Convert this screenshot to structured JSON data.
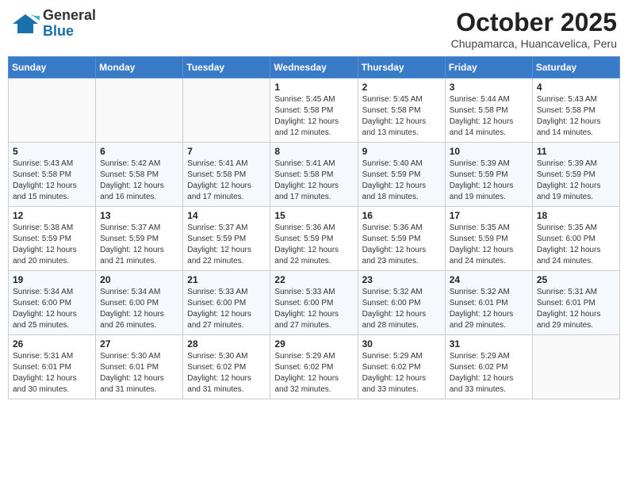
{
  "header": {
    "logo_general": "General",
    "logo_blue": "Blue",
    "month_year": "October 2025",
    "subtitle": "Chupamarca, Huancavelica, Peru"
  },
  "days_of_week": [
    "Sunday",
    "Monday",
    "Tuesday",
    "Wednesday",
    "Thursday",
    "Friday",
    "Saturday"
  ],
  "weeks": [
    [
      {
        "day": "",
        "info": ""
      },
      {
        "day": "",
        "info": ""
      },
      {
        "day": "",
        "info": ""
      },
      {
        "day": "1",
        "info": "Sunrise: 5:45 AM\nSunset: 5:58 PM\nDaylight: 12 hours\nand 12 minutes."
      },
      {
        "day": "2",
        "info": "Sunrise: 5:45 AM\nSunset: 5:58 PM\nDaylight: 12 hours\nand 13 minutes."
      },
      {
        "day": "3",
        "info": "Sunrise: 5:44 AM\nSunset: 5:58 PM\nDaylight: 12 hours\nand 14 minutes."
      },
      {
        "day": "4",
        "info": "Sunrise: 5:43 AM\nSunset: 5:58 PM\nDaylight: 12 hours\nand 14 minutes."
      }
    ],
    [
      {
        "day": "5",
        "info": "Sunrise: 5:43 AM\nSunset: 5:58 PM\nDaylight: 12 hours\nand 15 minutes."
      },
      {
        "day": "6",
        "info": "Sunrise: 5:42 AM\nSunset: 5:58 PM\nDaylight: 12 hours\nand 16 minutes."
      },
      {
        "day": "7",
        "info": "Sunrise: 5:41 AM\nSunset: 5:58 PM\nDaylight: 12 hours\nand 17 minutes."
      },
      {
        "day": "8",
        "info": "Sunrise: 5:41 AM\nSunset: 5:58 PM\nDaylight: 12 hours\nand 17 minutes."
      },
      {
        "day": "9",
        "info": "Sunrise: 5:40 AM\nSunset: 5:59 PM\nDaylight: 12 hours\nand 18 minutes."
      },
      {
        "day": "10",
        "info": "Sunrise: 5:39 AM\nSunset: 5:59 PM\nDaylight: 12 hours\nand 19 minutes."
      },
      {
        "day": "11",
        "info": "Sunrise: 5:39 AM\nSunset: 5:59 PM\nDaylight: 12 hours\nand 19 minutes."
      }
    ],
    [
      {
        "day": "12",
        "info": "Sunrise: 5:38 AM\nSunset: 5:59 PM\nDaylight: 12 hours\nand 20 minutes."
      },
      {
        "day": "13",
        "info": "Sunrise: 5:37 AM\nSunset: 5:59 PM\nDaylight: 12 hours\nand 21 minutes."
      },
      {
        "day": "14",
        "info": "Sunrise: 5:37 AM\nSunset: 5:59 PM\nDaylight: 12 hours\nand 22 minutes."
      },
      {
        "day": "15",
        "info": "Sunrise: 5:36 AM\nSunset: 5:59 PM\nDaylight: 12 hours\nand 22 minutes."
      },
      {
        "day": "16",
        "info": "Sunrise: 5:36 AM\nSunset: 5:59 PM\nDaylight: 12 hours\nand 23 minutes."
      },
      {
        "day": "17",
        "info": "Sunrise: 5:35 AM\nSunset: 5:59 PM\nDaylight: 12 hours\nand 24 minutes."
      },
      {
        "day": "18",
        "info": "Sunrise: 5:35 AM\nSunset: 6:00 PM\nDaylight: 12 hours\nand 24 minutes."
      }
    ],
    [
      {
        "day": "19",
        "info": "Sunrise: 5:34 AM\nSunset: 6:00 PM\nDaylight: 12 hours\nand 25 minutes."
      },
      {
        "day": "20",
        "info": "Sunrise: 5:34 AM\nSunset: 6:00 PM\nDaylight: 12 hours\nand 26 minutes."
      },
      {
        "day": "21",
        "info": "Sunrise: 5:33 AM\nSunset: 6:00 PM\nDaylight: 12 hours\nand 27 minutes."
      },
      {
        "day": "22",
        "info": "Sunrise: 5:33 AM\nSunset: 6:00 PM\nDaylight: 12 hours\nand 27 minutes."
      },
      {
        "day": "23",
        "info": "Sunrise: 5:32 AM\nSunset: 6:00 PM\nDaylight: 12 hours\nand 28 minutes."
      },
      {
        "day": "24",
        "info": "Sunrise: 5:32 AM\nSunset: 6:01 PM\nDaylight: 12 hours\nand 29 minutes."
      },
      {
        "day": "25",
        "info": "Sunrise: 5:31 AM\nSunset: 6:01 PM\nDaylight: 12 hours\nand 29 minutes."
      }
    ],
    [
      {
        "day": "26",
        "info": "Sunrise: 5:31 AM\nSunset: 6:01 PM\nDaylight: 12 hours\nand 30 minutes."
      },
      {
        "day": "27",
        "info": "Sunrise: 5:30 AM\nSunset: 6:01 PM\nDaylight: 12 hours\nand 31 minutes."
      },
      {
        "day": "28",
        "info": "Sunrise: 5:30 AM\nSunset: 6:02 PM\nDaylight: 12 hours\nand 31 minutes."
      },
      {
        "day": "29",
        "info": "Sunrise: 5:29 AM\nSunset: 6:02 PM\nDaylight: 12 hours\nand 32 minutes."
      },
      {
        "day": "30",
        "info": "Sunrise: 5:29 AM\nSunset: 6:02 PM\nDaylight: 12 hours\nand 33 minutes."
      },
      {
        "day": "31",
        "info": "Sunrise: 5:29 AM\nSunset: 6:02 PM\nDaylight: 12 hours\nand 33 minutes."
      },
      {
        "day": "",
        "info": ""
      }
    ]
  ]
}
